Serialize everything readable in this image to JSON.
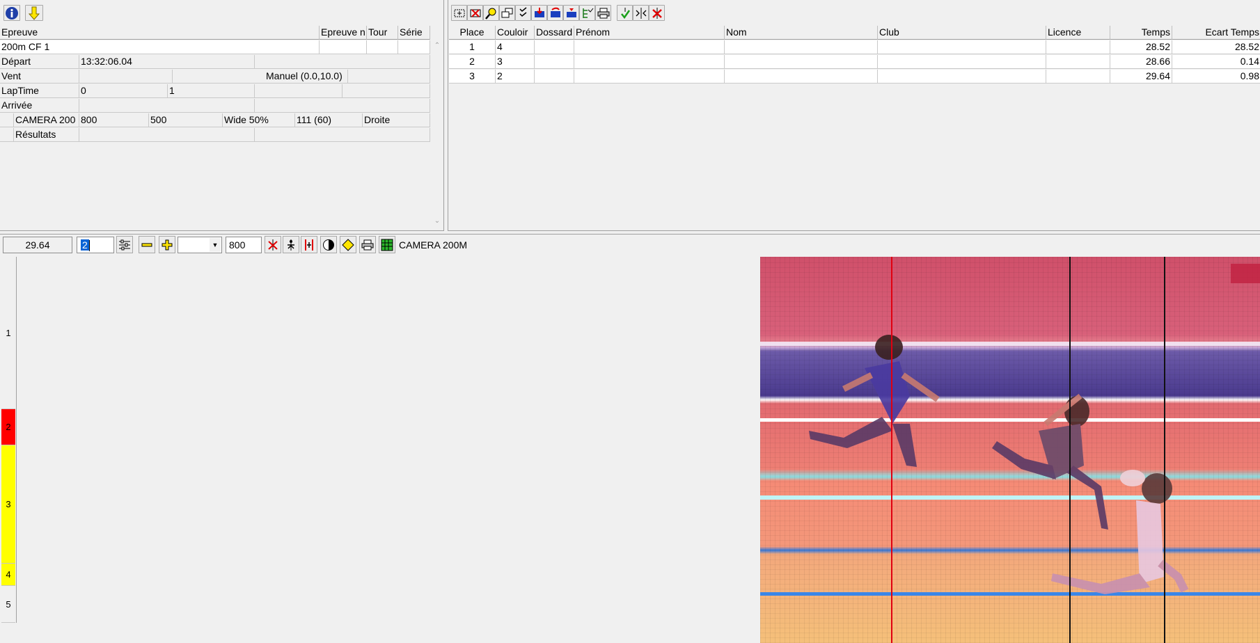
{
  "event_panel": {
    "headers": [
      "Epreuve",
      "Epreuve n",
      "Tour",
      "Série"
    ],
    "event_name": "200m CF 1",
    "rows": [
      {
        "label": "Départ",
        "cells": [
          "13:32:06.04",
          ""
        ]
      },
      {
        "label": "Vent",
        "cells": [
          "",
          "Manuel (0.0,10.0)",
          ""
        ]
      },
      {
        "label": "LapTime",
        "cells": [
          "0",
          "1",
          "",
          ""
        ]
      },
      {
        "label": "Arrivée",
        "cells": [
          "",
          ""
        ]
      }
    ],
    "camera_row": [
      "CAMERA 200",
      "800",
      "500",
      "Wide 50%",
      "111  (60)",
      "Droite"
    ],
    "results_label": "Résultats"
  },
  "results_table": {
    "headers": [
      "Place",
      "Couloir",
      "Dossard",
      "Prénom",
      "Nom",
      "Club",
      "Licence",
      "Temps",
      "Ecart Temps"
    ],
    "rows": [
      {
        "place": "1",
        "couloir": "4",
        "dossard": "",
        "prenom": "",
        "nom": "",
        "club": "",
        "licence": "",
        "temps": "28.52",
        "ecart": "28.52"
      },
      {
        "place": "2",
        "couloir": "3",
        "dossard": "",
        "prenom": "",
        "nom": "",
        "club": "",
        "licence": "",
        "temps": "28.66",
        "ecart": "0.14"
      },
      {
        "place": "3",
        "couloir": "2",
        "dossard": "",
        "prenom": "",
        "nom": "",
        "club": "",
        "licence": "",
        "temps": "29.64",
        "ecart": "0.98"
      }
    ]
  },
  "viewer_toolbar": {
    "time_value": "29.64",
    "lane_input": "2",
    "zoom_value": "800",
    "camera_label": "CAMERA 200M"
  },
  "lane_strip": {
    "lanes": [
      {
        "num": "1",
        "color": "#f0f0f0"
      },
      {
        "num": "2",
        "color": "#ff0000"
      },
      {
        "num": "3",
        "color": "#ffff00"
      },
      {
        "num": "4",
        "color": "#ffff00"
      },
      {
        "num": "5",
        "color": "#f0f0f0"
      }
    ]
  }
}
